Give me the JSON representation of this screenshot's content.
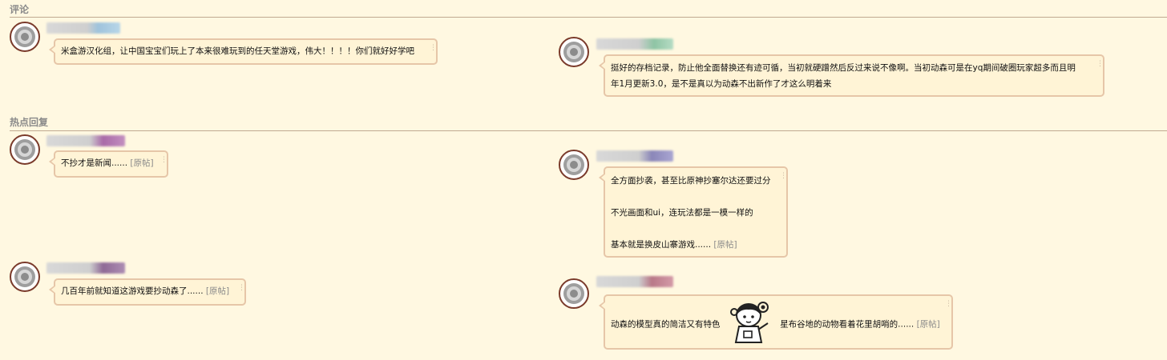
{
  "sections": {
    "comments_title": "评论",
    "hot_replies_title": "热点回复"
  },
  "comments": [
    {
      "text": "米盒游汉化组，让中国宝宝们玩上了本来很难玩到的任天堂游戏，伟大！！！！你们就好好学吧",
      "name_color": "#9fc3dc"
    },
    {
      "line1": "挺好的存档记录，防止他全面替换还有迹可循，当初就硬蹭然后反过来说不像啊。当初动森可是在yq期间破圈玩家超多而且明",
      "line2": "年1月更新3.0，是不是真以为动森不出新作了才这么明着来",
      "name_color": "#8ec4a4"
    }
  ],
  "hot_replies": [
    {
      "text": "不抄才是新闻......",
      "link": "[原帖]",
      "name_color": "#a96aa8"
    },
    {
      "p1": "全方面抄袭，甚至比原神抄塞尔达还要过分",
      "p2": "不光画面和ui，连玩法都是一模一样的",
      "p3": "基本就是换皮山寨游戏......",
      "link": "[原帖]",
      "name_color": "#8a86b8"
    },
    {
      "text": "几百年前就知道这游戏要抄动森了......",
      "link": "[原帖]",
      "name_color": "#8f6a96"
    },
    {
      "text_before": "动森的模型真的简洁又有特色",
      "text_after": "星布谷地的动物看着花里胡哨的......",
      "link": "[原帖]",
      "name_color": "#b87888",
      "sticker": "anime-girl-sticker-icon"
    }
  ],
  "colors": {
    "page_bg": "#fff8e1",
    "bubble_bg": "#fff4d6",
    "bubble_border": "#e6c6a8",
    "avatar_border": "#7a3a2a",
    "muted_text": "#8a8a8a"
  }
}
